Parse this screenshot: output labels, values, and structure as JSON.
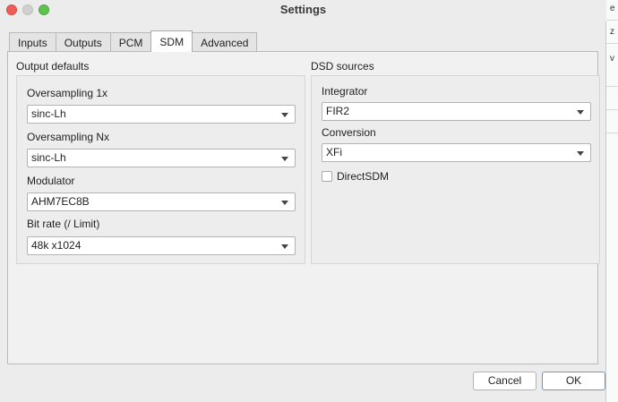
{
  "window": {
    "title": "Settings"
  },
  "side_texts": [
    "e",
    "z",
    "v"
  ],
  "tabs": [
    {
      "label": "Inputs"
    },
    {
      "label": "Outputs"
    },
    {
      "label": "PCM"
    },
    {
      "label": "SDM"
    },
    {
      "label": "Advanced"
    }
  ],
  "output_defaults": {
    "title": "Output defaults",
    "oversampling_1x": {
      "label": "Oversampling 1x",
      "value": "sinc-Lh"
    },
    "oversampling_nx": {
      "label": "Oversampling Nx",
      "value": "sinc-Lh"
    },
    "modulator": {
      "label": "Modulator",
      "value": "AHM7EC8B"
    },
    "bit_rate": {
      "label": "Bit rate (/ Limit)",
      "value": "48k x1024"
    }
  },
  "dsd_sources": {
    "title": "DSD sources",
    "integrator": {
      "label": "Integrator",
      "value": "FIR2"
    },
    "conversion": {
      "label": "Conversion",
      "value": "XFi"
    },
    "direct_sdm": {
      "label": "DirectSDM",
      "checked": false
    }
  },
  "buttons": {
    "cancel": "Cancel",
    "ok": "OK"
  }
}
